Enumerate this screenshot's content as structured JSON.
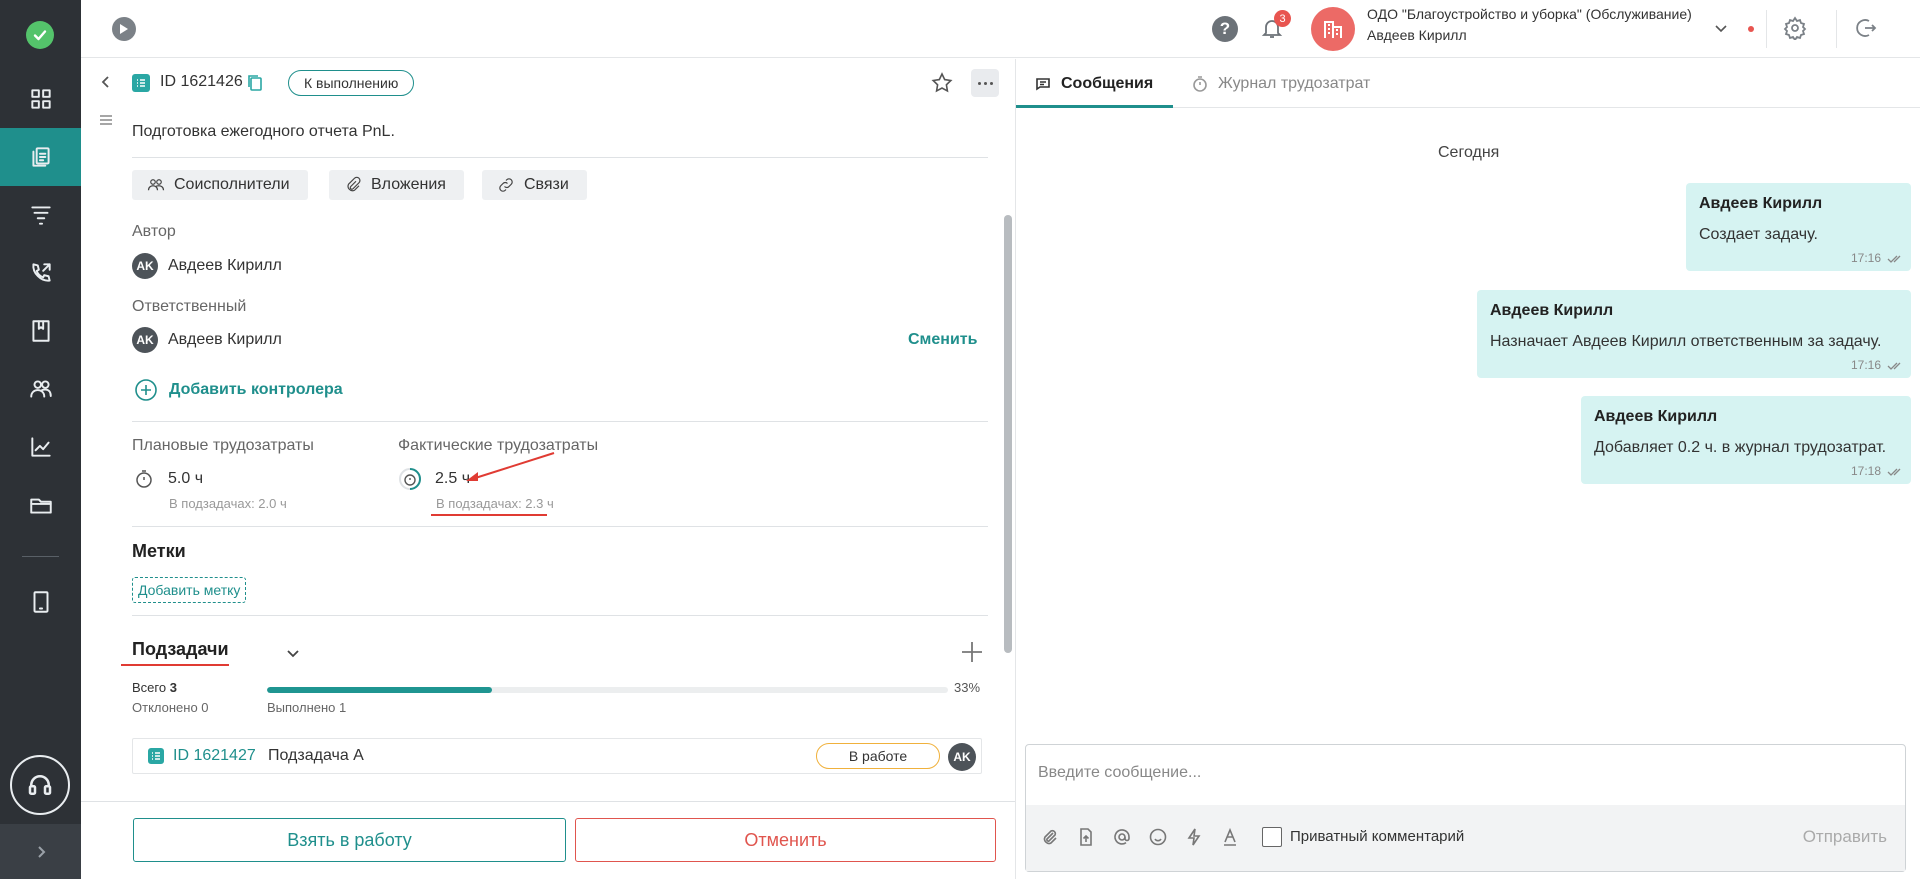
{
  "topbar": {
    "notifications_count": "3",
    "org_name": "ОДО \"Благоустройство и уборка\" (Обслуживание)",
    "user_name": "Авдеев Кирилл"
  },
  "task": {
    "id": "ID 1621426",
    "status": "К выполнению",
    "title": "Подготовка ежегодного отчета PnL.",
    "chips": [
      "Соисполнители",
      "Вложения",
      "Связи"
    ],
    "author_label": "Автор",
    "author_initials": "AK",
    "author_name": "Авдеев Кирилл",
    "responsible_label": "Ответственный",
    "responsible_initials": "AK",
    "responsible_name": "Авдеев Кирилл",
    "change_link": "Сменить",
    "add_controller": "Добавить контролера",
    "planned_label": "Плановые трудозатраты",
    "planned_hours": "5.0 ч",
    "planned_sub": "В подзадачах: 2.0 ч",
    "actual_label": "Фактические трудозатраты",
    "actual_hours": "2.5 ч",
    "actual_sub": "В подзадачах: 2.3 ч",
    "tags_title": "Метки",
    "add_tag": "Добавить метку",
    "subtasks_title": "Подзадачи",
    "total_label": "Всего",
    "total_value": "3",
    "rejected": "Отклонено 0",
    "done": "Выполнено 1",
    "progress_percent": 33,
    "progress_label": "33%",
    "subtasks": [
      {
        "id": "ID 1621427",
        "name": "Подзадача А",
        "status": "В работе",
        "assignee_initials": "AK"
      }
    ],
    "take_button": "Взять в работу",
    "cancel_button": "Отменить"
  },
  "chat": {
    "tabs": [
      "Сообщения",
      "Журнал трудозатрат"
    ],
    "date_separator": "Сегодня",
    "messages": [
      {
        "author": "Авдеев Кирилл",
        "text": "Создает задачу.",
        "time": "17:16"
      },
      {
        "author": "Авдеев Кирилл",
        "text": "Назначает Авдеев Кирилл ответственным за задачу.",
        "time": "17:16"
      },
      {
        "author": "Авдеев Кирилл",
        "text": "Добавляет 0.2 ч. в журнал трудозатрат.",
        "time": "17:18"
      }
    ],
    "input_placeholder": "Введите сообщение...",
    "private_comment": "Приватный комментарий",
    "send": "Отправить"
  },
  "colors": {
    "accent": "#1f8f8c",
    "sidebar": "#2d3136",
    "danger": "#e0554e",
    "bubble": "#d6f3f2"
  }
}
